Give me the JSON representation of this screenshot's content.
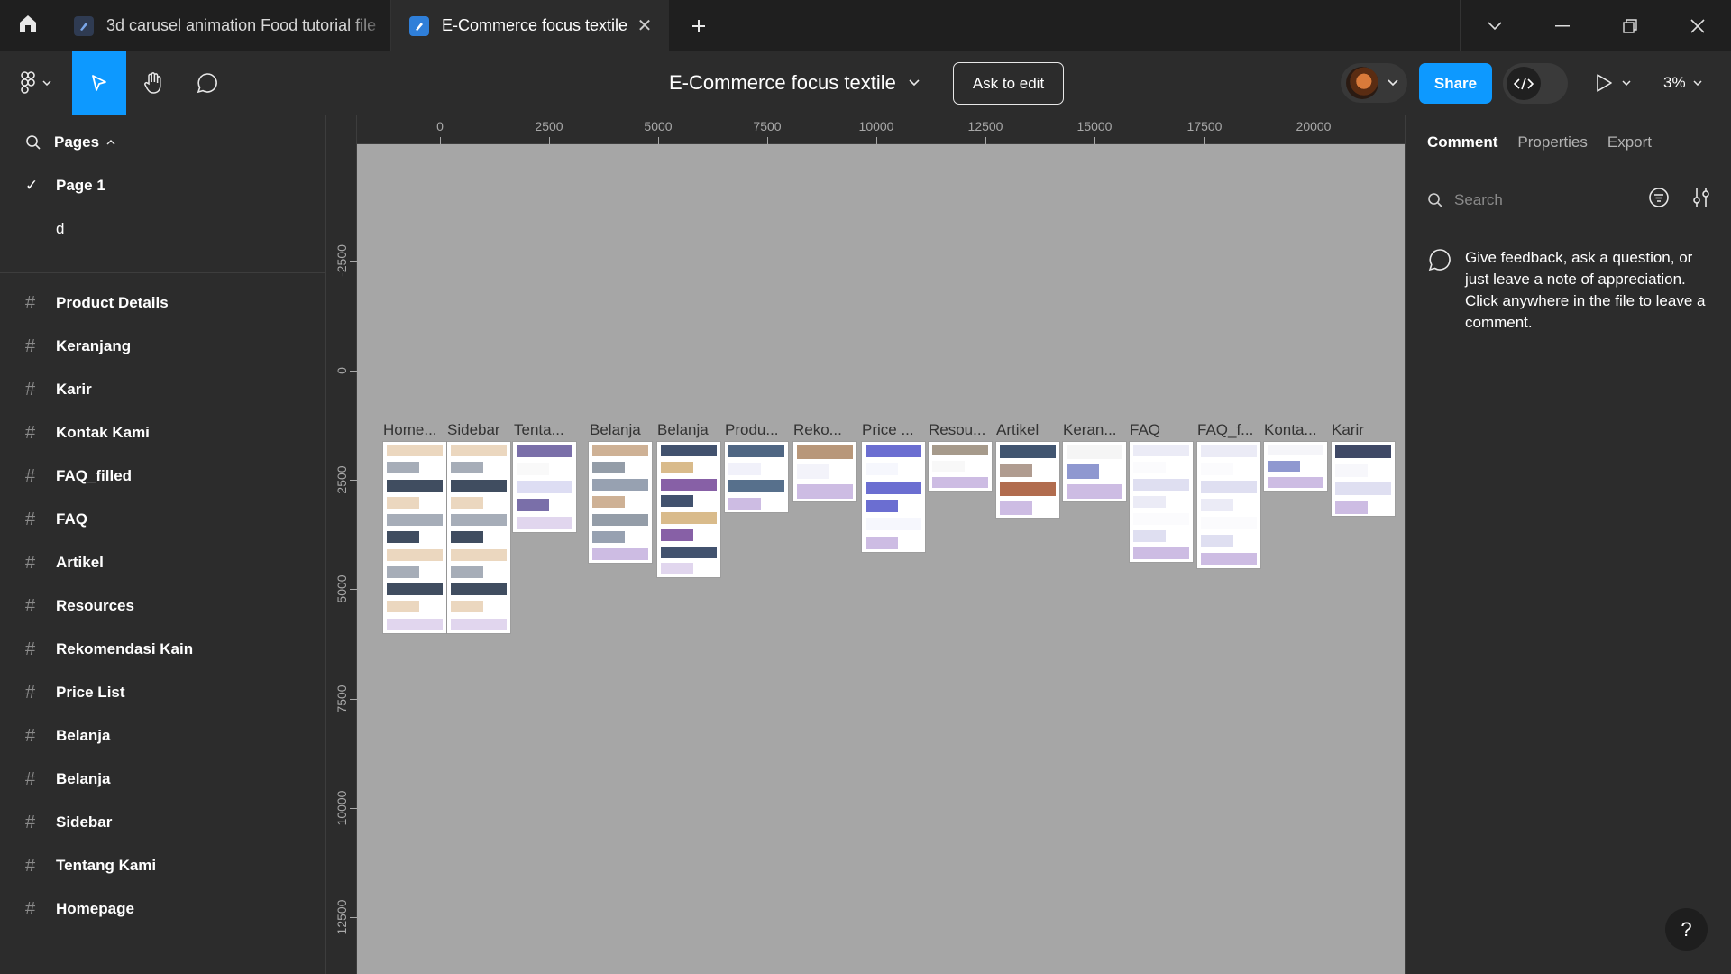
{
  "tabs": [
    {
      "label": "3d carusel animation Food tutorial file"
    },
    {
      "label": "E-Commerce focus textile"
    }
  ],
  "toolbar": {
    "file_title": "E-Commerce focus textile",
    "ask_to_edit": "Ask to edit",
    "share": "Share",
    "zoom": "3%"
  },
  "left": {
    "pages_header": "Pages",
    "pages": [
      "Page 1",
      "d"
    ],
    "layers": [
      "Product Details",
      "Keranjang",
      "Karir",
      "Kontak Kami",
      "FAQ_filled",
      "FAQ",
      "Artikel",
      "Resources",
      "Rekomendasi Kain",
      "Price List",
      "Belanja",
      "Belanja",
      "Sidebar",
      "Tentang Kami",
      "Homepage"
    ]
  },
  "rulers": {
    "top": [
      "0",
      "2500",
      "5000",
      "7500",
      "10000",
      "12500",
      "15000",
      "17500",
      "20000"
    ],
    "left": [
      "-2500",
      "0",
      "2500",
      "5000",
      "7500",
      "10000",
      "12500"
    ]
  },
  "canvas": {
    "frames": [
      "Home...",
      "Sidebar",
      "Tenta...",
      "Belanja",
      "Belanja",
      "Produ...",
      "Reko...",
      "Price ...",
      "Resou...",
      "Artikel",
      "Keran...",
      "FAQ",
      "FAQ_f...",
      "Konta...",
      "Karir"
    ]
  },
  "right": {
    "tabs": [
      "Comment",
      "Properties",
      "Export"
    ],
    "search_placeholder": "Search",
    "empty_message": "Give feedback, ask a question, or just leave a note of appreciation. Click anywhere in the file to leave a comment."
  },
  "colors": {
    "accent": "#0d99ff",
    "canvas": "#a6a6a6",
    "panel": "#2c2c2c"
  },
  "icons": [
    "home-icon",
    "figma-menu-icon",
    "move-tool-icon",
    "hand-tool-icon",
    "comment-tool-icon",
    "play-icon",
    "chevron-down-icon",
    "search-icon",
    "filter-icon",
    "settings-icon",
    "help-icon"
  ]
}
